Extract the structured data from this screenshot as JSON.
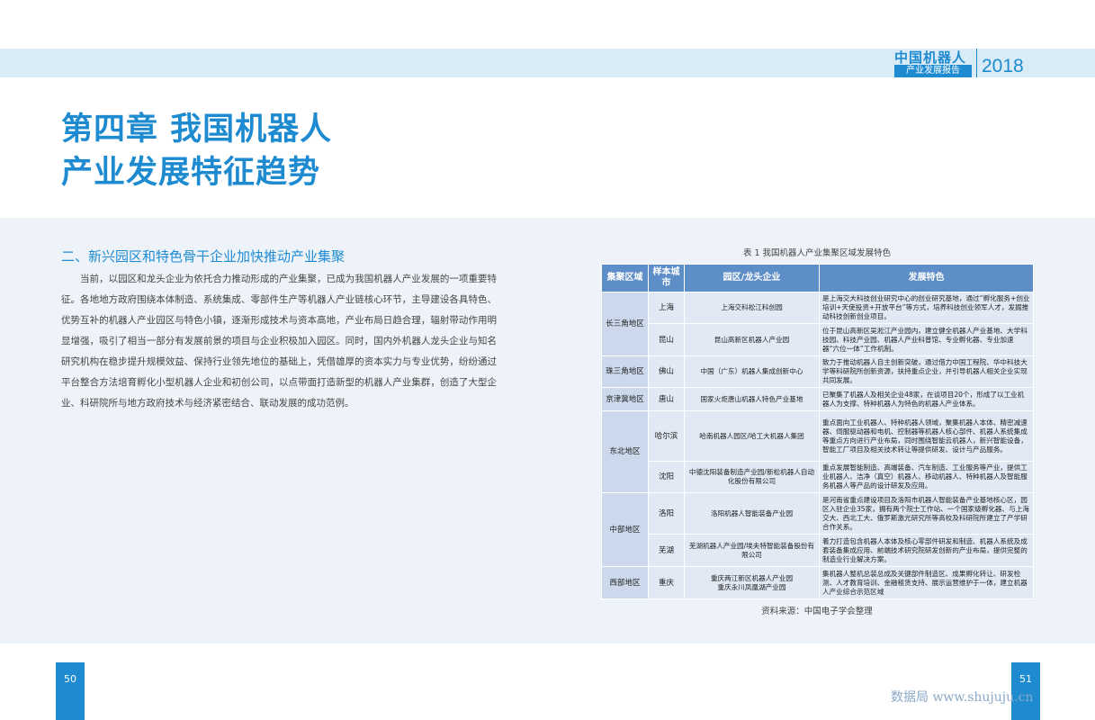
{
  "header": {
    "brand_title": "中国机器人",
    "brand_subtitle": "产业发展报告",
    "brand_year": "2018"
  },
  "chapter": {
    "line1": "第四章  我国机器人",
    "line2": "产业发展特征趋势"
  },
  "section": {
    "heading": "二、新兴园区和特色骨干企业加快推动产业集聚",
    "paragraph": "当前，以园区和龙头企业为依托合力推动形成的产业集聚，已成为我国机器人产业发展的一项重要特征。各地地方政府围绕本体制造、系统集成、零部件生产等机器人产业链核心环节，主导建设各具特色、优势互补的机器人产业园区与特色小镇，逐渐形成技术与资本高地，产业布局日趋合理，辐射带动作用明显增强，吸引了相当一部分有发展前景的项目与企业积极加入园区。同时，国内外机器人龙头企业与知名研究机构在稳步提升规模效益、保持行业领先地位的基础上，凭借雄厚的资本实力与专业优势，纷纷通过平台整合方法培育孵化小型机器人企业和初创公司，以点带面打造新型的机器人产业集群，创造了大型企业、科研院所与地方政府技术与经济紧密结合、联动发展的成功范例。"
  },
  "table": {
    "caption": "表 1  我国机器人产业集聚区域发展特色",
    "headers": {
      "region": "集聚区域",
      "city": "样本城市",
      "park": "园区/龙头企业",
      "feature": "发展特色"
    },
    "rows": [
      {
        "region": "长三角地区",
        "city": "上海",
        "park": "上海交科松江科创园",
        "feature": "是上海交大科技创业研究中心的创业研究基地，通过“孵化服务+创业培训+天使投资+开放平台”等方式，培养科技创业领军人才，发掘推动科技创新创业项目。"
      },
      {
        "city": "昆山",
        "park": "昆山高新区机器人产业园",
        "feature": "位于昆山高新区吴淞江产业园内，建立健全机器人产业基地、大学科技园、科技产业园、机器人产业科普馆、专业孵化器、专业加速器“六位一体”工作机制。"
      },
      {
        "region": "珠三角地区",
        "city": "佛山",
        "park": "中国（广东）机器人集成创新中心",
        "feature": "致力于推动机器人自主创新突破，通过借力中国工程院、华中科技大学等科研院所创新资源，扶持重点企业，并引导机器人相关企业实现共同发展。"
      },
      {
        "region": "京津冀地区",
        "city": "唐山",
        "park": "国家火炬唐山机器人特色产业基地",
        "feature": "已聚集了机器人及相关企业48家，在谈项目20个，形成了以工业机器人为支撑、特种机器人为特色的机器人产业体系。"
      },
      {
        "region": "东北地区",
        "city": "哈尔滨",
        "park": "哈南机器人园区/哈工大机器人集团",
        "feature": "重点面向工业机器人、特种机器人领域，聚集机器人本体、精密减速器、伺服驱动器和电机、控制器等机器人核心部件、机器人系统集成等重点方向进行产业布局，同时围绕智能云机器人，新兴智能设备，智能工厂项目及相关技术转让等提供研发、设计与产品服务。"
      },
      {
        "city": "沈阳",
        "park": "中德沈阳装备制造产业园/新松机器人自动化股份有限公司",
        "feature": "重点发展智能制造、高端装备、汽车制造、工业服务等产业，提供工业机器人、洁净（真空）机器人、移动机器人、特种机器人及智能服务机器人等产品的设计研发及应用。"
      },
      {
        "region": "中部地区",
        "city": "洛阳",
        "park": "洛阳机器人智能装备产业园",
        "feature": "是河南省重点建设项目及洛阳市机器人智能装备产业基地核心区，园区入驻企业35家，拥有两个院士工作站、一个国家级孵化器、与上海交大、西北工大、俄罗斯激光研究所等高校及科研院所建立了产学研合作关系。"
      },
      {
        "city": "芜湖",
        "park": "芜湖机器人产业园/埃夫特智能装备股份有限公司",
        "feature": "着力打造包含机器人本体及核心零部件研发和制造、机器人系统及成套装备集成应用、前端技术研究院研发创新的产业布局，提供完整的制造业行业解决方案。"
      },
      {
        "region": "西部地区",
        "city": "重庆",
        "park": "重庆两江新区机器人产业园\n重庆永川凤凰湖产业园",
        "feature": "集机器人整机总装总成及关键部件制造区、成果孵化转让、研发检测、人才教育培训、金融租赁支持、展示运营维护于一体，建立机器人产业综合示范区域"
      }
    ],
    "source": "资料来源：中国电子学会整理"
  },
  "footer": {
    "page_left": "50",
    "page_right": "51",
    "watermark": "数据局 www.shujuju.cn"
  },
  "colors": {
    "accent": "#1e8bd1",
    "header_band": "#d9ebf7",
    "content_bg": "#eef3f9",
    "table_header": "#5e8ec7"
  }
}
